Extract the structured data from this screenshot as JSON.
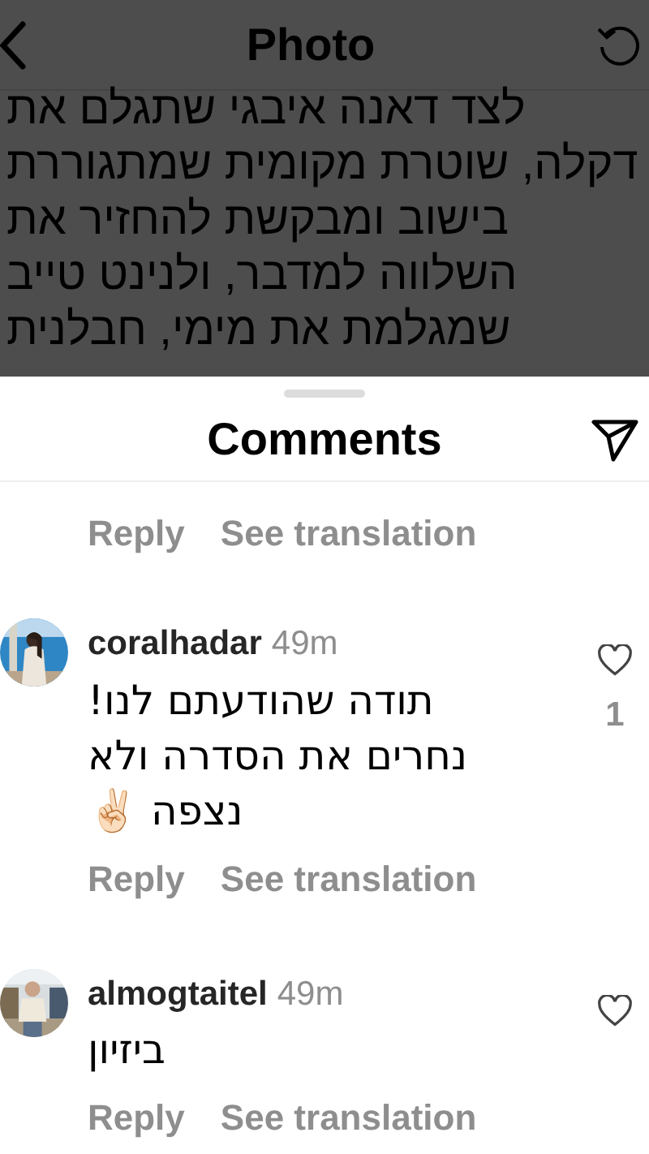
{
  "header": {
    "title": "Photo"
  },
  "caption_lines": [
    "לצד דאנה איבגי שתגלם את",
    "דקלה, שוטרת מקומית שמתגוררת",
    "בישוב ומבקשת להחזיר את",
    "השלווה למדבר, ולנינט טייב",
    "שמגלמת את מימי, חבלנית"
  ],
  "comments_sheet": {
    "title": "Comments",
    "previous_comment_actions": {
      "reply": "Reply",
      "translation": "See translation"
    },
    "comments": [
      {
        "username": "coralhadar",
        "time": "49m",
        "text": "תודה שהודעתם לנו! נחרים את הסדרה ולא נצפה ✌🏻",
        "likes": "1",
        "actions": {
          "reply": "Reply",
          "translation": "See translation"
        }
      },
      {
        "username": "almogtaitel",
        "time": "49m",
        "text": "ביזיון",
        "actions": {
          "reply": "Reply",
          "translation": "See translation"
        }
      }
    ]
  }
}
